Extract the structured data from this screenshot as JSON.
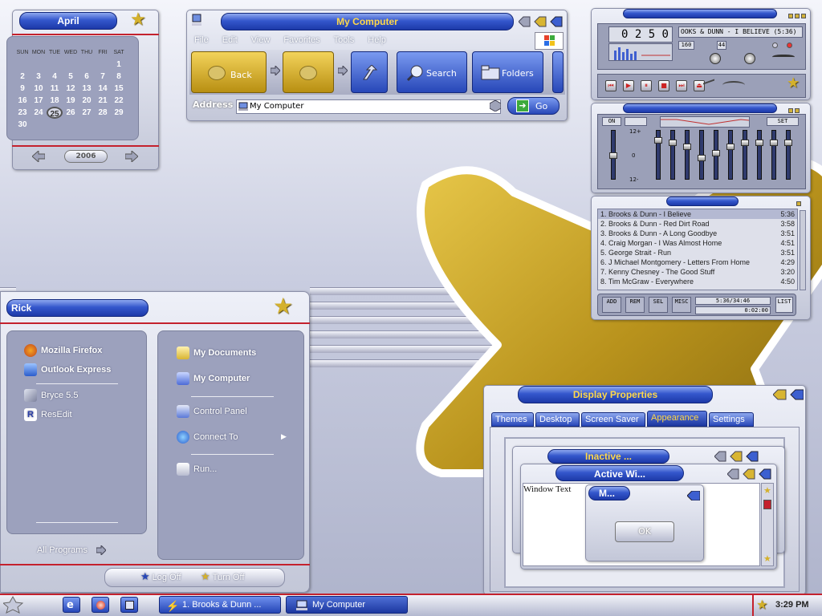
{
  "calendar": {
    "month": "April",
    "year": "2006",
    "weekdays": [
      "SUN",
      "MON",
      "TUE",
      "WED",
      "THU",
      "FRI",
      "SAT"
    ],
    "weeks": [
      [
        "",
        "",
        "",
        "",
        "",
        "",
        "1"
      ],
      [
        "2",
        "3",
        "4",
        "5",
        "6",
        "7",
        "8"
      ],
      [
        "9",
        "10",
        "11",
        "12",
        "13",
        "14",
        "15"
      ],
      [
        "16",
        "17",
        "18",
        "19",
        "20",
        "21",
        "22"
      ],
      [
        "23",
        "24",
        "25",
        "26",
        "27",
        "28",
        "29"
      ],
      [
        "30",
        "",
        "",
        "",
        "",
        "",
        ""
      ]
    ],
    "today": "25"
  },
  "explorer": {
    "title": "My Computer",
    "menu": [
      "File",
      "Edit",
      "View",
      "Favorites",
      "Tools",
      "Help"
    ],
    "back_label": "Back",
    "search_label": "Search",
    "folders_label": "Folders",
    "address_label": "Address",
    "address_value": "My Computer",
    "go_label": "Go"
  },
  "winamp": {
    "time": "0 2 5 0",
    "song_marquee": "OOKS & DUNN - I BELIEVE (5:36)",
    "kbps": "160",
    "khz": "44",
    "eq_on": "ON",
    "eq_auto": "",
    "eq_preset": "SET",
    "eq_labels": [
      "12+",
      "0",
      "12-"
    ],
    "eq_levels": [
      0.5,
      0.15,
      0.2,
      0.3,
      0.55,
      0.45,
      0.3,
      0.2,
      0.2,
      0.2,
      0.2
    ],
    "playlist": [
      {
        "title": "1. Brooks & Dunn - I Believe",
        "time": "5:36"
      },
      {
        "title": "2. Brooks & Dunn - Red Dirt Road",
        "time": "3:58"
      },
      {
        "title": "3. Brooks & Dunn - A Long Goodbye",
        "time": "3:51"
      },
      {
        "title": "4. Craig Morgan - I Was Almost Home",
        "time": "4:51"
      },
      {
        "title": "5. George Strait - Run",
        "time": "3:51"
      },
      {
        "title": "6. J Michael Montgomery - Letters From Home",
        "time": "4:29"
      },
      {
        "title": "7. Kenny Chesney - The Good Stuff",
        "time": "3:20"
      },
      {
        "title": "8. Tim McGraw - Everywhere",
        "time": "4:50"
      }
    ],
    "pl_buttons": [
      "ADD",
      "REM",
      "SEL",
      "MISC"
    ],
    "pl_total": "5:36/34:46",
    "pl_pos": "0:02:00",
    "list_label": "LIST"
  },
  "start_menu": {
    "user": "Rick",
    "left_pinned": [
      "Mozilla Firefox",
      "Outlook Express"
    ],
    "left_recent": [
      "Bryce 5.5",
      "ResEdit"
    ],
    "all_programs": "All Programs",
    "right_items": [
      "My Documents",
      "My Computer"
    ],
    "right_items2": [
      "Control Panel",
      "Connect To"
    ],
    "run": "Run...",
    "log_off": "Log Off",
    "turn_off": "Turn Off"
  },
  "display_props": {
    "title": "Display Properties",
    "tabs": [
      "Themes",
      "Desktop",
      "Screen Saver",
      "Appearance",
      "Settings"
    ],
    "active_tab": "Appearance",
    "inactive_title": "Inactive ...",
    "active_title": "Active Wi...",
    "window_text": "Window Text",
    "msg_title": "M...",
    "ok_label": "OK"
  },
  "taskbar": {
    "items": [
      "1. Brooks & Dunn ...",
      "My Computer"
    ],
    "clock": "3:29 PM"
  }
}
